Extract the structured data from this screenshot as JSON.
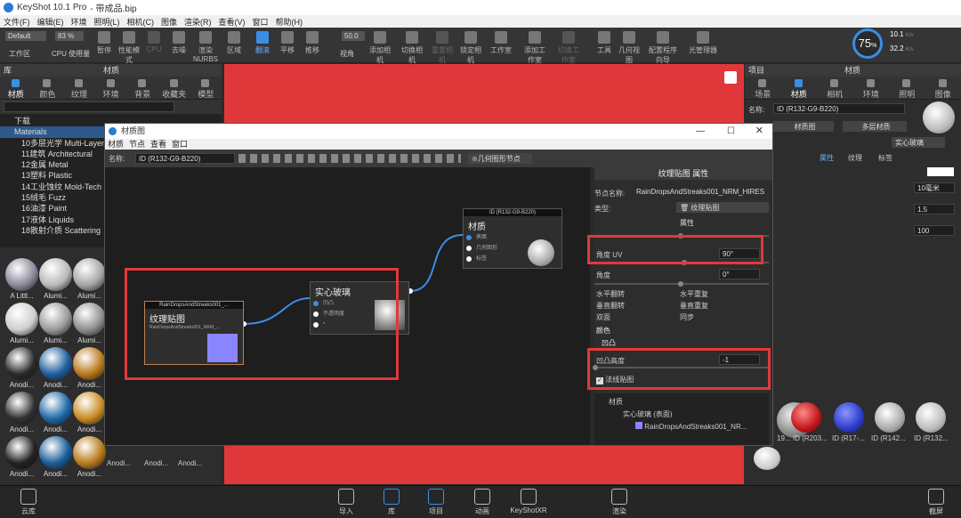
{
  "window": {
    "app": "KeyShot 10.1 Pro",
    "file": "- 带成品.bip"
  },
  "menu": [
    "文件(F)",
    "编辑(E)",
    "环境",
    "照明(L)",
    "相机(C)",
    "图像",
    "渲染(R)",
    "查看(V)",
    "窗口",
    "帮助(H)"
  ],
  "toolbar": {
    "preset": "Default",
    "zoom": "83 %",
    "fov": "50.0",
    "items": [
      "工作区",
      "CPU 使用量",
      "暂停",
      "性能模式",
      "CPU",
      "去噪",
      "渲染NURBS",
      "区域",
      "翻滚",
      "平移",
      "推移",
      "视角",
      "添加相机",
      "切换相机",
      "重置相机",
      "锁定相机",
      "工作室",
      "添加工作室",
      "切换工作室",
      "工具",
      "几何视图",
      "配置程序向导",
      "光管理器"
    ],
    "active_item": "翻滚"
  },
  "perf": {
    "percent": "75",
    "unit": "%",
    "net_up": "10.1",
    "net_up_unit": "K/s",
    "net_down": "32.2",
    "net_down_unit": "K/s"
  },
  "library": {
    "title": "库",
    "panel_title": "材质",
    "tabs": [
      "材质",
      "颜色",
      "纹理",
      "环境",
      "背景",
      "收藏夹",
      "模型"
    ],
    "tree": [
      "下载",
      "Materials",
      "10多层光学 Multi-Layer",
      "11建筑 Architectural",
      "12金属 Metal",
      "13塑料 Plastic",
      "14工业蚀纹 Mold-Tech",
      "15绒毛 Fuzz",
      "16油漆 Paint",
      "17液体 Liquids",
      "18散射介质 Scattering"
    ],
    "thumbs": [
      {
        "label": "A Littl...",
        "color": "#8a8a9a"
      },
      {
        "label": "Alumi...",
        "color": "#b9b9b9"
      },
      {
        "label": "Alumi...",
        "color": "#a5a5a5"
      },
      {
        "label": "Alumi...",
        "color": "#cfcfcf"
      },
      {
        "label": "Alumi...",
        "color": "#9a9a9a"
      },
      {
        "label": "Alumi...",
        "color": "#8f8f8f"
      },
      {
        "label": "Anodi...",
        "color": "#2a2a2a"
      },
      {
        "label": "Anodi...",
        "color": "#1f5f9f"
      },
      {
        "label": "Anodi...",
        "color": "#b9781c"
      },
      {
        "label": "Anodi...",
        "color": "#303030"
      },
      {
        "label": "Anodi...",
        "color": "#1e6aa8"
      },
      {
        "label": "Anodi...",
        "color": "#c98a22"
      },
      {
        "label": "Anodi...",
        "color": "#222222"
      },
      {
        "label": "Anodi...",
        "color": "#1a5e9a"
      },
      {
        "label": "Anodi...",
        "color": "#b87b1d"
      }
    ],
    "extra_labels": [
      "Anodi...",
      "Anodi...",
      "Anodi..."
    ]
  },
  "project": {
    "title": "项目",
    "panel_title": "材质",
    "tabs": [
      "场景",
      "材质",
      "相机",
      "环境",
      "照明",
      "图像"
    ],
    "name_label": "名称:",
    "name_value": "ID (R132-G9-B220)",
    "btn_graph": "材质图",
    "btn_multi": "多层材质",
    "type_value": "实心玻璃",
    "subtabs": [
      "属性",
      "纹理",
      "标签"
    ],
    "v1": "10毫米",
    "v2": "1.5",
    "v3": "100",
    "row_labels": [
      "19...",
      "ID (R203...",
      "ID (R17-...",
      "ID (R142...",
      "ID (R132..."
    ]
  },
  "bottom": [
    "云库",
    "导入",
    "库",
    "项目",
    "动画",
    "KeyShotXR",
    "渲染",
    "截屏"
  ],
  "dialog": {
    "title": "材质图",
    "menu": [
      "材质",
      "节点",
      "查看",
      "窗口"
    ],
    "name_label": "名称:",
    "name_value": "ID (R132-G9-B220)",
    "geo_btn": "几何图形节点",
    "node_tex": {
      "head": "RainDropsAndStreaks001_...",
      "title": "纹理贴图",
      "sub": "RainDropsAndStreaks001_NRM_..."
    },
    "node_glass": {
      "title": "实心玻璃",
      "ports": [
        "凹凸",
        "不透明度",
        "*"
      ]
    },
    "node_mat": {
      "head": "ID (R132-G9-B220)",
      "title": "材质",
      "ports": [
        "表面",
        "几何图形",
        "标签"
      ]
    },
    "props": {
      "header": "纹理贴图  属性",
      "node_name_label": "节点名称:",
      "node_name": "RainDropsAndStreaks001_NRM_HIRES",
      "type_label": "类型:",
      "type_value": "纹理贴图",
      "tab": "属性",
      "angle_uv_label": "角度 UV",
      "angle_uv": "90°",
      "angle_label": "角度",
      "angle": "0°",
      "flip_h": "水平翻转",
      "repeat_h": "水平重复",
      "flip_v": "垂直翻转",
      "repeat_v": "垂直重复",
      "double": "双面",
      "sync": "同步",
      "color_section": "颜色",
      "bump_section": "凹凸",
      "bump_height_label": "凹凸高度",
      "bump_height": "-1",
      "normal_map": "法线贴图",
      "tree": [
        "材质",
        "实心玻璃 (表面)",
        "RainDropsAndStreaks001_NR..."
      ]
    }
  }
}
